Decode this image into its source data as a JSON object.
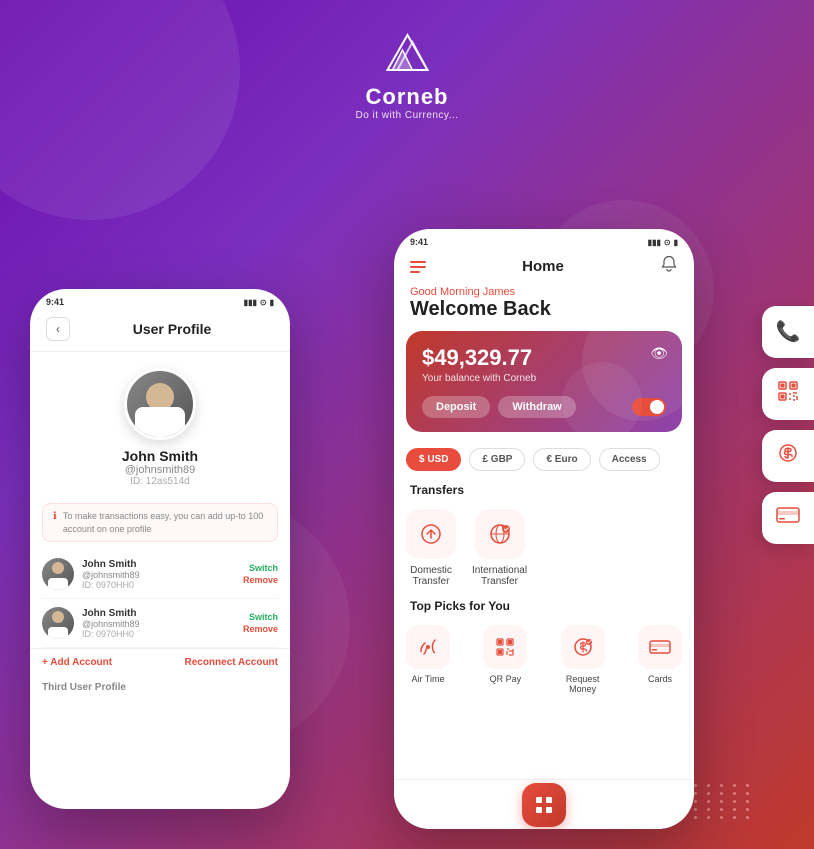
{
  "app": {
    "brand_name": "Corneb",
    "brand_tagline": "Do it with Currency...",
    "background_colors": [
      "#6a0dad",
      "#7b2fbe",
      "#c0392b"
    ]
  },
  "left_phone": {
    "status_time": "9:41",
    "title": "User Profile",
    "back_label": "<",
    "user": {
      "name": "John Smith",
      "username": "@johnsmith89",
      "id": "ID: 12as514d"
    },
    "notice": "To make transactions easy, you can add up-to 100 account on one profile",
    "accounts": [
      {
        "name": "John Smith",
        "username": "@johnsmith89",
        "id": "ID: 0970HH0",
        "switch": "Switch",
        "remove": "Remove"
      },
      {
        "name": "John Smith",
        "username": "@johnsmith89",
        "id": "ID: 0970HH0",
        "switch": "Switch",
        "remove": "Remove"
      }
    ],
    "add_account": "+ Add Account",
    "reconnect": "Reconnect Account",
    "third_profile": "Third User Profile"
  },
  "right_phone": {
    "status_time": "9:41",
    "title": "Home",
    "greeting_sub": "Good Morning James",
    "greeting_main": "Welcome Back",
    "balance": {
      "amount": "$49,329.77",
      "label": "Your balance with Corneb",
      "deposit_btn": "Deposit",
      "withdraw_btn": "Withdraw"
    },
    "currencies": [
      {
        "label": "$ USD",
        "active": true
      },
      {
        "label": "£ GBP",
        "active": false
      },
      {
        "label": "€ Euro",
        "active": false
      },
      {
        "label": "Access",
        "active": false
      }
    ],
    "transfers_title": "Transfers",
    "transfers": [
      {
        "label": "Domestic\nTransfer",
        "icon": "↕"
      },
      {
        "label": "International\nTransfer",
        "icon": "🌐"
      }
    ],
    "picks_title": "Top Picks for You",
    "picks": [
      {
        "label": "Air Time",
        "icon": "📞"
      },
      {
        "label": "QR Pay",
        "icon": "⊞"
      },
      {
        "label": "Request\nMoney",
        "icon": "💲"
      },
      {
        "label": "Cards",
        "icon": "💳"
      }
    ]
  },
  "floating_buttons": [
    {
      "icon": "📞",
      "name": "call-button"
    },
    {
      "icon": "⊞",
      "name": "qr-button"
    },
    {
      "icon": "💲",
      "name": "money-button"
    },
    {
      "icon": "💳",
      "name": "card-button"
    }
  ]
}
